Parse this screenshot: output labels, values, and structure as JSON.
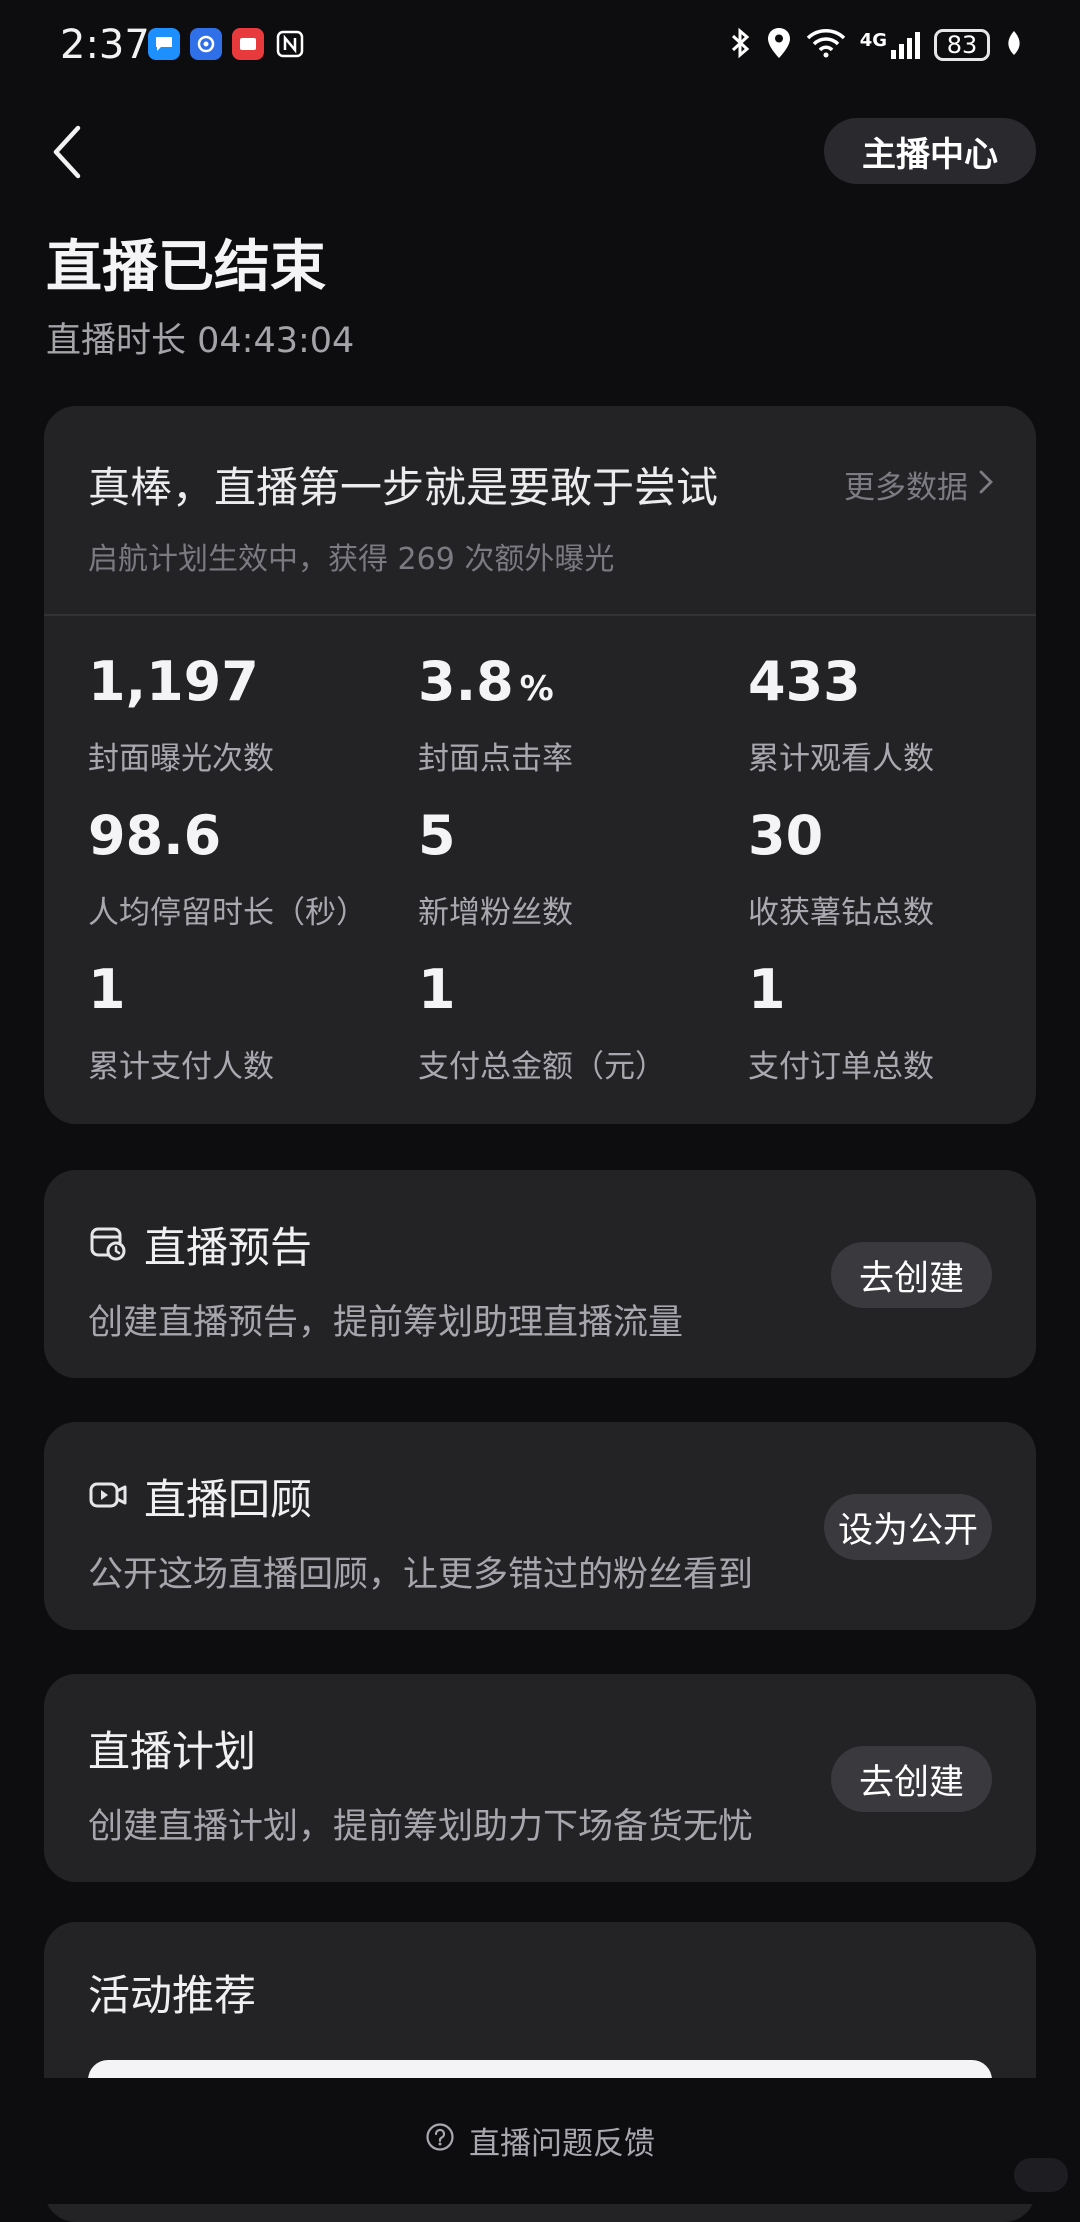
{
  "status_bar": {
    "time": "2:37",
    "battery": "83",
    "network": "4G",
    "notification_icons": [
      "message-icon",
      "browser-icon",
      "mail-icon",
      "nfc-icon"
    ],
    "system_icons": [
      "bluetooth-icon",
      "location-icon",
      "wifi-icon",
      "signal-icon",
      "battery-icon",
      "leaf-icon"
    ]
  },
  "header": {
    "anchor_center_label": "主播中心",
    "title": "直播已结束",
    "duration": "直播时长 04:43:04"
  },
  "summary": {
    "headline": "真棒，直播第一步就是要敢于尝试",
    "more_data_label": "更多数据",
    "subtitle": "启航计划生效中，获得 269 次额外曝光",
    "stats": [
      {
        "value": "1,197",
        "unit": "",
        "label": "封面曝光次数"
      },
      {
        "value": "3.8",
        "unit": "%",
        "label": "封面点击率"
      },
      {
        "value": "433",
        "unit": "",
        "label": "累计观看人数"
      },
      {
        "value": "98.6",
        "unit": "",
        "label": "人均停留时长（秒）"
      },
      {
        "value": "5",
        "unit": "",
        "label": "新增粉丝数"
      },
      {
        "value": "30",
        "unit": "",
        "label": "收获薯钻总数"
      },
      {
        "value": "1",
        "unit": "",
        "label": "累计支付人数"
      },
      {
        "value": "1",
        "unit": "",
        "label": "支付总金额（元）"
      },
      {
        "value": "1",
        "unit": "",
        "label": "支付订单总数"
      }
    ]
  },
  "features": [
    {
      "title": "直播预告",
      "desc": "创建直播预告，提前筹划助理直播流量",
      "button": "去创建",
      "icon": "calendar-clock-icon"
    },
    {
      "title": "直播回顾",
      "desc": "公开这场直播回顾，让更多错过的粉丝看到",
      "button": "设为公开",
      "icon": "video-camera-icon"
    },
    {
      "title": "直播计划",
      "desc": "创建直播计划，提前筹划助力下场备货无忧",
      "button": "去创建",
      "icon": ""
    }
  ],
  "activity": {
    "title": "活动推荐"
  },
  "footer": {
    "feedback_label": "直播问题反馈"
  }
}
